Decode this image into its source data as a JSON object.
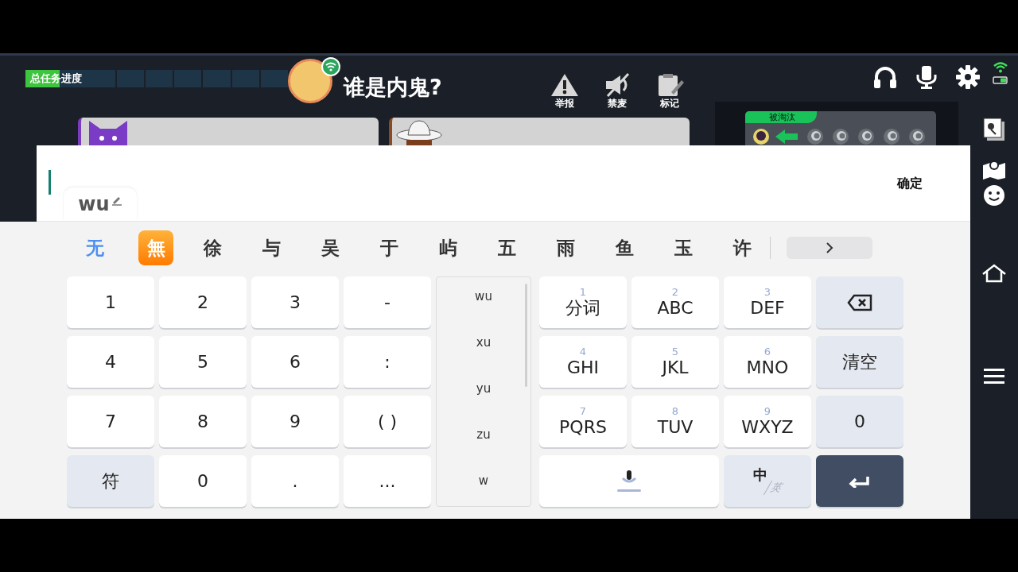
{
  "hud": {
    "progress_label": "总任务进度",
    "progress": {
      "level": 0.13
    },
    "title": "谁是内鬼?",
    "actions": [
      {
        "label": "举报",
        "kind": "report"
      },
      {
        "label": "禁麦",
        "kind": "mute"
      },
      {
        "label": "标记",
        "kind": "mark"
      }
    ],
    "eliminated_label": "被淘汰"
  },
  "input": {
    "preedit": "wu",
    "confirm": "确定"
  },
  "candidates": [
    {
      "text": "无",
      "kind": "char",
      "selected": true
    },
    {
      "text": "無",
      "kind": "emoji",
      "selected": false
    },
    {
      "text": "徐",
      "kind": "char",
      "selected": false
    },
    {
      "text": "与",
      "kind": "char",
      "selected": false
    },
    {
      "text": "吴",
      "kind": "char",
      "selected": false
    },
    {
      "text": "于",
      "kind": "char",
      "selected": false
    },
    {
      "text": "屿",
      "kind": "char",
      "selected": false
    },
    {
      "text": "五",
      "kind": "char",
      "selected": false
    },
    {
      "text": "雨",
      "kind": "char",
      "selected": false
    },
    {
      "text": "鱼",
      "kind": "char",
      "selected": false
    },
    {
      "text": "玉",
      "kind": "char",
      "selected": false
    },
    {
      "text": "许",
      "kind": "char",
      "selected": false
    }
  ],
  "left_keys": [
    {
      "label": "1",
      "kind": "char"
    },
    {
      "label": "2",
      "kind": "char"
    },
    {
      "label": "3",
      "kind": "char"
    },
    {
      "label": "-",
      "kind": "char"
    },
    {
      "label": "4",
      "kind": "char"
    },
    {
      "label": "5",
      "kind": "char"
    },
    {
      "label": "6",
      "kind": "char"
    },
    {
      "label": ":",
      "kind": "char"
    },
    {
      "label": "7",
      "kind": "char"
    },
    {
      "label": "8",
      "kind": "char"
    },
    {
      "label": "9",
      "kind": "char"
    },
    {
      "label": "( )",
      "kind": "char"
    },
    {
      "label": "符",
      "kind": "func"
    },
    {
      "label": "0",
      "kind": "char"
    },
    {
      "label": ".",
      "kind": "char"
    },
    {
      "label": "...",
      "kind": "char"
    }
  ],
  "pinyin": [
    "wu",
    "xu",
    "yu",
    "zu",
    "w"
  ],
  "right_keys": [
    {
      "hint": "1",
      "label": "分词",
      "kind": "char"
    },
    {
      "hint": "2",
      "label": "ABC",
      "kind": "char"
    },
    {
      "hint": "3",
      "label": "DEF",
      "kind": "char"
    },
    {
      "kind": "backspace"
    },
    {
      "hint": "4",
      "label": "GHI",
      "kind": "char"
    },
    {
      "hint": "5",
      "label": "JKL",
      "kind": "char"
    },
    {
      "hint": "6",
      "label": "MNO",
      "kind": "char"
    },
    {
      "label": "清空",
      "kind": "func"
    },
    {
      "hint": "7",
      "label": "PQRS",
      "kind": "char"
    },
    {
      "hint": "8",
      "label": "TUV",
      "kind": "char"
    },
    {
      "hint": "9",
      "label": "WXYZ",
      "kind": "char"
    },
    {
      "label": "0",
      "kind": "func"
    },
    {
      "kind": "voice"
    },
    {
      "label": "中",
      "sub": "英",
      "kind": "lang"
    },
    {
      "kind": "enter"
    }
  ]
}
